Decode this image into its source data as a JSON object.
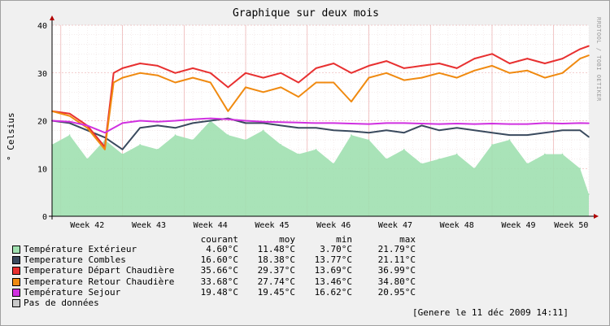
{
  "chart_data": {
    "type": "area",
    "title": "Graphique sur deux mois",
    "ylabel": "° Celsius",
    "ylim": [
      0,
      40
    ],
    "yticks": [
      0,
      10,
      20,
      30,
      40
    ],
    "xlim": [
      "2009-10-11",
      "2009-12-11"
    ],
    "x_tick_labels": [
      "Week 42",
      "Week 43",
      "Week 44",
      "Week 45",
      "Week 46",
      "Week 47",
      "Week 48",
      "Week 49",
      "Week 50"
    ],
    "grid": true,
    "legend_placement": "bottom",
    "stat_headers": [
      "courant",
      "moy",
      "min",
      "max"
    ],
    "series": [
      {
        "name": "Température Extérieur",
        "style": "area",
        "color": "#a0e0b0",
        "stats": [
          "4.60°C",
          "11.48°C",
          "3.70°C",
          "21.79°C"
        ],
        "x": [
          "2009-10-11",
          "2009-10-13",
          "2009-10-15",
          "2009-10-17",
          "2009-10-19",
          "2009-10-21",
          "2009-10-23",
          "2009-10-25",
          "2009-10-27",
          "2009-10-29",
          "2009-10-31",
          "2009-11-02",
          "2009-11-04",
          "2009-11-06",
          "2009-11-08",
          "2009-11-10",
          "2009-11-12",
          "2009-11-14",
          "2009-11-16",
          "2009-11-18",
          "2009-11-20",
          "2009-11-22",
          "2009-11-24",
          "2009-11-26",
          "2009-11-28",
          "2009-11-30",
          "2009-12-02",
          "2009-12-04",
          "2009-12-06",
          "2009-12-08",
          "2009-12-10",
          "2009-12-11"
        ],
        "y": [
          15,
          17,
          12,
          16,
          13,
          15,
          14,
          17,
          16,
          20,
          17,
          16,
          18,
          15,
          13,
          14,
          11,
          17,
          16,
          12,
          14,
          11,
          12,
          13,
          10,
          15,
          16,
          11,
          13,
          13,
          10,
          4.6
        ]
      },
      {
        "name": "Temperature Combles",
        "style": "line",
        "color": "#3a4a5e",
        "stats": [
          "16.60°C",
          "18.38°C",
          "13.77°C",
          "21.11°C"
        ],
        "x": [
          "2009-10-11",
          "2009-10-13",
          "2009-10-15",
          "2009-10-17",
          "2009-10-19",
          "2009-10-21",
          "2009-10-23",
          "2009-10-25",
          "2009-10-27",
          "2009-10-29",
          "2009-10-31",
          "2009-11-02",
          "2009-11-04",
          "2009-11-06",
          "2009-11-08",
          "2009-11-10",
          "2009-11-12",
          "2009-11-14",
          "2009-11-16",
          "2009-11-18",
          "2009-11-20",
          "2009-11-22",
          "2009-11-24",
          "2009-11-26",
          "2009-11-28",
          "2009-11-30",
          "2009-12-02",
          "2009-12-04",
          "2009-12-06",
          "2009-12-08",
          "2009-12-10",
          "2009-12-11"
        ],
        "y": [
          20,
          19.5,
          18,
          16.5,
          14,
          18.5,
          19,
          18.5,
          19.5,
          20,
          20.5,
          19.5,
          19.5,
          19,
          18.5,
          18.5,
          18,
          17.8,
          17.5,
          18,
          17.5,
          19,
          18,
          18.5,
          18,
          17.5,
          17,
          17,
          17.5,
          18,
          18,
          16.6
        ]
      },
      {
        "name": "Temperature Départ Chaudière",
        "style": "line",
        "color": "#e83030",
        "stats": [
          "35.66°C",
          "29.37°C",
          "13.69°C",
          "36.99°C"
        ],
        "x": [
          "2009-10-11",
          "2009-10-13",
          "2009-10-15",
          "2009-10-17",
          "2009-10-18",
          "2009-10-19",
          "2009-10-21",
          "2009-10-23",
          "2009-10-25",
          "2009-10-27",
          "2009-10-29",
          "2009-10-31",
          "2009-11-02",
          "2009-11-04",
          "2009-11-06",
          "2009-11-08",
          "2009-11-10",
          "2009-11-12",
          "2009-11-14",
          "2009-11-16",
          "2009-11-18",
          "2009-11-20",
          "2009-11-22",
          "2009-11-24",
          "2009-11-26",
          "2009-11-28",
          "2009-11-30",
          "2009-12-02",
          "2009-12-04",
          "2009-12-06",
          "2009-12-08",
          "2009-12-10",
          "2009-12-11"
        ],
        "y": [
          22,
          21.5,
          19,
          14.5,
          30,
          31,
          32,
          31.5,
          30,
          31,
          30,
          27,
          30,
          29,
          30,
          28,
          31,
          32,
          30,
          31.5,
          32.5,
          31,
          31.5,
          32,
          31,
          33,
          34,
          32,
          33,
          32,
          33,
          35,
          35.66
        ]
      },
      {
        "name": "Temperature Retour Chaudière",
        "style": "line",
        "color": "#f08a10",
        "stats": [
          "33.68°C",
          "27.74°C",
          "13.46°C",
          "34.80°C"
        ],
        "x": [
          "2009-10-11",
          "2009-10-13",
          "2009-10-15",
          "2009-10-17",
          "2009-10-18",
          "2009-10-19",
          "2009-10-21",
          "2009-10-23",
          "2009-10-25",
          "2009-10-27",
          "2009-10-29",
          "2009-10-31",
          "2009-11-02",
          "2009-11-04",
          "2009-11-06",
          "2009-11-08",
          "2009-11-10",
          "2009-11-12",
          "2009-11-14",
          "2009-11-16",
          "2009-11-18",
          "2009-11-20",
          "2009-11-22",
          "2009-11-24",
          "2009-11-26",
          "2009-11-28",
          "2009-11-30",
          "2009-12-02",
          "2009-12-04",
          "2009-12-06",
          "2009-12-08",
          "2009-12-10",
          "2009-12-11"
        ],
        "y": [
          22,
          21,
          18.5,
          14,
          28,
          29,
          30,
          29.5,
          28,
          29,
          28,
          22,
          27,
          26,
          27,
          25,
          28,
          28,
          24,
          29,
          30,
          28.5,
          29,
          30,
          29,
          30.5,
          31.5,
          30,
          30.5,
          29,
          30,
          33,
          33.68
        ]
      },
      {
        "name": "Température Sejour",
        "style": "line",
        "color": "#d030e0",
        "stats": [
          "19.48°C",
          "19.45°C",
          "16.62°C",
          "20.95°C"
        ],
        "x": [
          "2009-10-11",
          "2009-10-13",
          "2009-10-15",
          "2009-10-17",
          "2009-10-19",
          "2009-10-21",
          "2009-10-23",
          "2009-10-25",
          "2009-10-27",
          "2009-10-29",
          "2009-10-31",
          "2009-11-02",
          "2009-11-04",
          "2009-11-06",
          "2009-11-08",
          "2009-11-10",
          "2009-11-12",
          "2009-11-14",
          "2009-11-16",
          "2009-11-18",
          "2009-11-20",
          "2009-11-22",
          "2009-11-24",
          "2009-11-26",
          "2009-11-28",
          "2009-11-30",
          "2009-12-02",
          "2009-12-04",
          "2009-12-06",
          "2009-12-08",
          "2009-12-10",
          "2009-12-11"
        ],
        "y": [
          20,
          19.8,
          19,
          17.5,
          19.5,
          20,
          19.8,
          20,
          20.3,
          20.5,
          20.3,
          20,
          19.8,
          19.7,
          19.6,
          19.5,
          19.5,
          19.4,
          19.3,
          19.5,
          19.5,
          19.4,
          19.3,
          19.4,
          19.3,
          19.4,
          19.3,
          19.3,
          19.5,
          19.4,
          19.5,
          19.48
        ]
      },
      {
        "name": "Pas de données",
        "style": "legend-only",
        "color": "#c8c8c8",
        "stats": [
          "",
          "",
          "",
          ""
        ],
        "x": [],
        "y": []
      }
    ]
  },
  "watermark": "RRDTOOL / TOBI OETIKER",
  "footer": "[Genere le 11 déc 2009 14:11]"
}
